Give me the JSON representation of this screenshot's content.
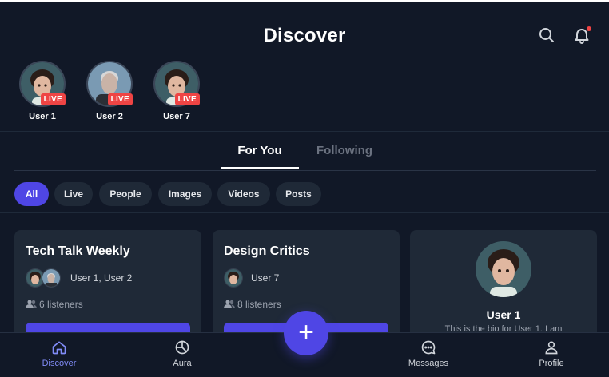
{
  "header": {
    "title": "Discover",
    "icons": [
      "search-icon",
      "bell-icon"
    ]
  },
  "stories": [
    {
      "name": "User 1",
      "badge": "LIVE"
    },
    {
      "name": "User 2",
      "badge": "LIVE"
    },
    {
      "name": "User 7",
      "badge": "LIVE"
    }
  ],
  "tabs": {
    "active": "For You",
    "inactive": "Following"
  },
  "filters": [
    "All",
    "Live",
    "People",
    "Images",
    "Videos",
    "Posts"
  ],
  "cards": [
    {
      "title": "Tech Talk Weekly",
      "hosts": "User 1, User 2",
      "listeners": "6 listeners"
    },
    {
      "title": "Design Critics",
      "hosts": "User 7",
      "listeners": "8 listeners"
    }
  ],
  "profile_card": {
    "name": "User 1",
    "bio": "This is the bio for User 1. I am"
  },
  "nav": [
    {
      "label": "Discover",
      "icon": "home-icon"
    },
    {
      "label": "Aura",
      "icon": "aura-icon"
    },
    {
      "label": "Messages",
      "icon": "chat-icon"
    },
    {
      "label": "Profile",
      "icon": "user-icon"
    }
  ],
  "fab": {
    "symbol": "+"
  },
  "colors": {
    "accent": "#4f46e5",
    "live": "#ef4444",
    "background": "#111827",
    "card": "#1f2937"
  }
}
